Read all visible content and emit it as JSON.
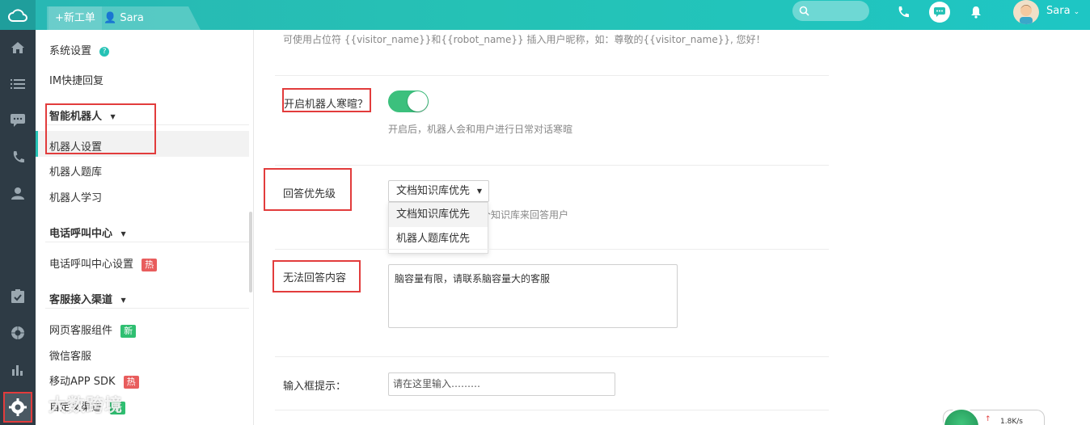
{
  "topbar": {
    "new_ticket": "+新工单",
    "user_tab": "Sara",
    "search_placeholder": "",
    "user_name": "Sara"
  },
  "sidebar": {
    "system_settings": "系统设置",
    "im_quick_reply": "IM快捷回复",
    "section_robot": "智能机器人",
    "robot_settings": "机器人设置",
    "robot_qa": "机器人题库",
    "robot_learning": "机器人学习",
    "section_callcenter": "电话呼叫中心",
    "callcenter_settings": "电话呼叫中心设置",
    "badge_hot": "热",
    "section_channels": "客服接入渠道",
    "web_widget": "网页客服组件",
    "badge_new": "新",
    "wechat": "微信客服",
    "mobile_sdk": "移动APP SDK",
    "custom_channel": "自定义渠道"
  },
  "main": {
    "placeholder_hint": "可使用占位符 {{visitor_name}}和{{robot_name}} 插入用户昵称，如：尊敬的{{visitor_name}}, 您好！",
    "greet_label": "开启机器人寒暄？",
    "greet_enabled": true,
    "greet_hint": "开启后，机器人会和用户进行日常对话寒暄",
    "priority_label": "回答优先级",
    "priority_selected": "文档知识库优先",
    "priority_options": [
      "文档知识库优先",
      "机器人题库优先"
    ],
    "priority_hint_partial": "个知识库来回答用户",
    "unanswerable_label": "无法回答内容",
    "unanswerable_value": "脑容量有限，请联系脑容量大的客服",
    "input_hint_label": "输入框提示：",
    "input_hint_value": "请在这里输入………"
  },
  "widgets": {
    "net_speed": "1.8K/s",
    "watermark": "大数跨境"
  },
  "colors": {
    "brand": "#25c2b5",
    "rail": "#2e3b45",
    "toggle_on": "#3cc07d",
    "annotation": "#e23c3c"
  }
}
